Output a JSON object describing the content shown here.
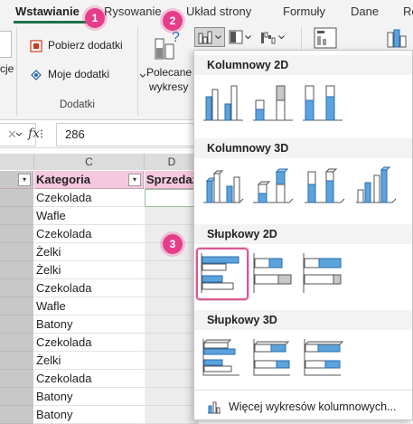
{
  "ribbon": {
    "tabs": [
      "Wstawianie",
      "Rysowanie",
      "Układ strony",
      "Formuły",
      "Dane",
      "Re"
    ],
    "left_cut_label": "cje",
    "addins": {
      "get_label": "Pobierz dodatki",
      "my_label": "Moje dodatki",
      "group_label": "Dodatki"
    },
    "recommended": {
      "line1": "Polecane",
      "line2": "wykresy"
    }
  },
  "formula_bar": {
    "fx": "fx",
    "value": "286"
  },
  "grid": {
    "columns": [
      "C",
      "D"
    ],
    "headers": {
      "kategoria": "Kategoria",
      "sprzedaz": "Sprzedaż"
    },
    "rows": [
      "Czekolada",
      "Wafle",
      "Czekolada",
      "Żelki",
      "Żelki",
      "Czekolada",
      "Wafle",
      "Batony",
      "Czekolada",
      "Żelki",
      "Czekolada",
      "Batony",
      "Batony"
    ]
  },
  "dropdown": {
    "sections": [
      "Kolumnowy 2D",
      "Kolumnowy 3D",
      "Słupkowy 2D",
      "Słupkowy 3D"
    ],
    "more_label": "Więcej wykresów kolumnowych..."
  },
  "badges": [
    "1",
    "2",
    "3"
  ],
  "colors": {
    "accent_green": "#1e7145",
    "badge_pink": "#e63d8a",
    "header_pink": "#f6c8df",
    "chart_blue": "#5ba3dd"
  }
}
